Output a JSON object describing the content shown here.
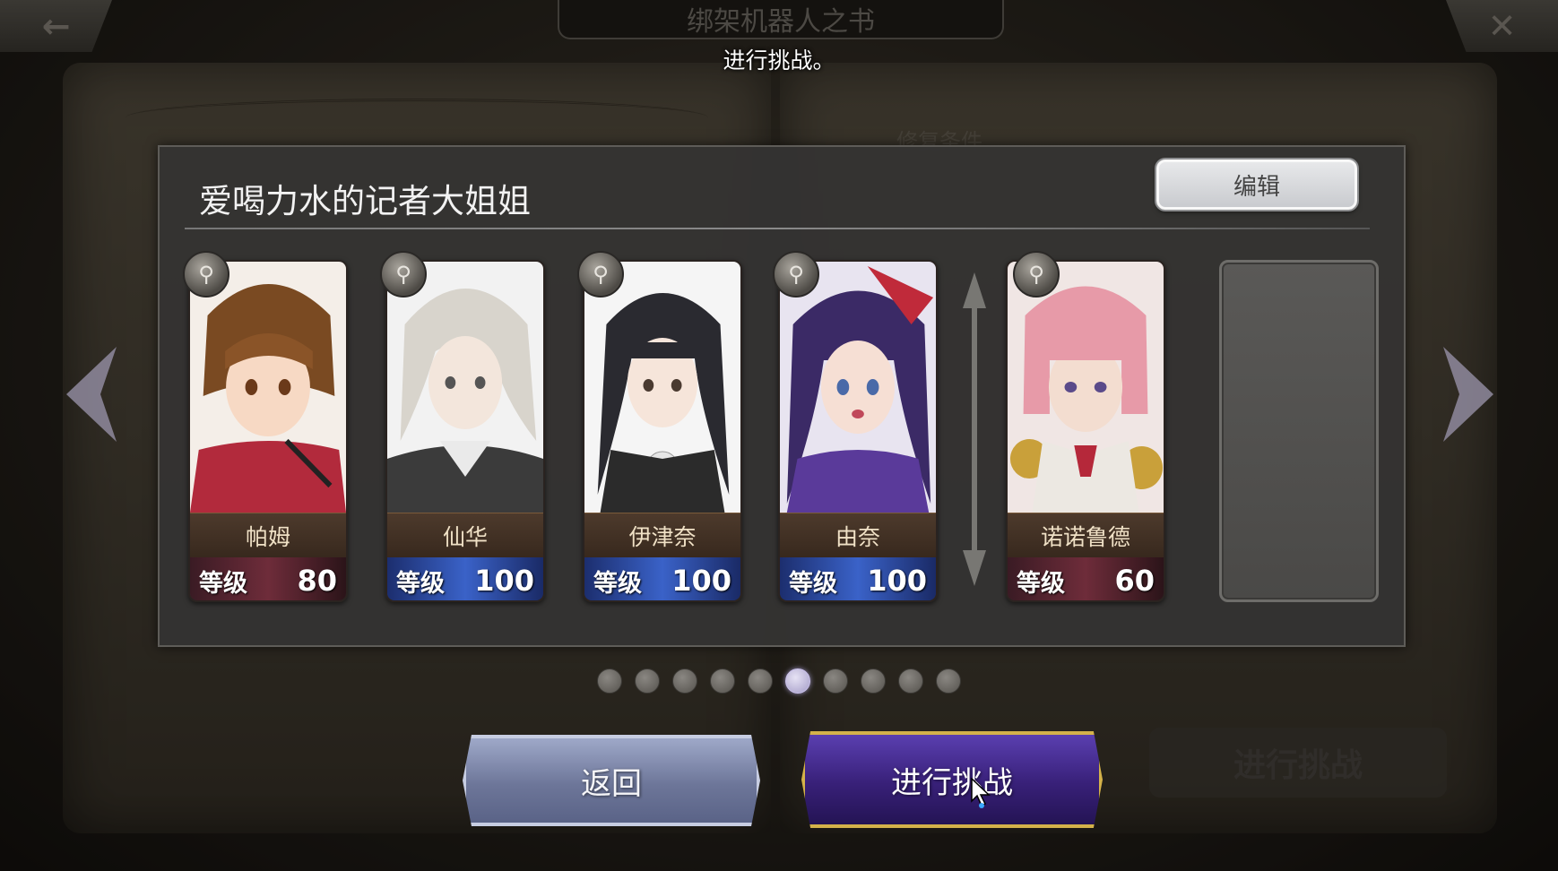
{
  "top": {
    "back_glyph": "←",
    "close_glyph": "✕",
    "book_title": "绑架机器人之书",
    "caption": "进行挑战。"
  },
  "background": {
    "ghost_header": "修复条件",
    "challenge_label": "进行挑战"
  },
  "team": {
    "name": "爱喝力水的记者大姐姐",
    "edit_label": "编辑",
    "members": [
      {
        "name": "帕姆",
        "level_label": "等级",
        "level": "80",
        "frame": "red"
      },
      {
        "name": "仙华",
        "level_label": "等级",
        "level": "100",
        "frame": "blue"
      },
      {
        "name": "伊津奈",
        "level_label": "等级",
        "level": "100",
        "frame": "blue"
      },
      {
        "name": "由奈",
        "level_label": "等级",
        "level": "100",
        "frame": "blue"
      },
      {
        "name": "诺诺鲁德",
        "level_label": "等级",
        "level": "60",
        "frame": "red"
      }
    ]
  },
  "pagination": {
    "total": 10,
    "active_index": 5
  },
  "buttons": {
    "back_label": "返回",
    "challenge_label": "进行挑战"
  },
  "colors": {
    "panel": "#343332",
    "accent_gold": "#d4b24a",
    "accent_purple": "#382078"
  }
}
